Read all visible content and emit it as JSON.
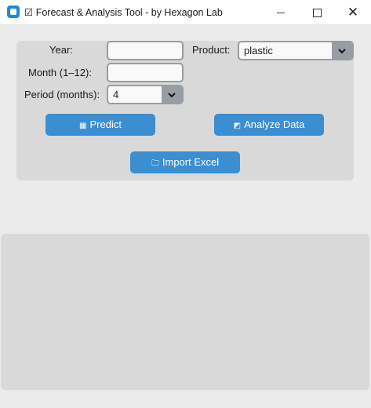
{
  "window": {
    "title_checkbox_glyph": "☑",
    "title": "Forecast & Analysis Tool - by Hexagon Lab",
    "icon": "app-icon",
    "controls": {
      "minimize_icon": "minimize-icon",
      "maximize_icon": "maximize-icon",
      "close_glyph": "✕"
    }
  },
  "form": {
    "year_label": "Year:",
    "year_value": "",
    "month_label": "Month (1–12):",
    "month_value": "",
    "period_label": "Period (months):",
    "period_value": "4",
    "product_label": "Product:",
    "product_value": "plastic"
  },
  "buttons": {
    "predict_icon": "▦",
    "predict_label": "Predict",
    "analyze_icon": "◩",
    "analyze_label": "Analyze Data",
    "import_icon": "🗀",
    "import_label": "Import Excel"
  },
  "colors": {
    "accent": "#3b8ed0",
    "panel": "#d9d9d9",
    "background": "#ebebeb",
    "field_border": "#979da2"
  }
}
